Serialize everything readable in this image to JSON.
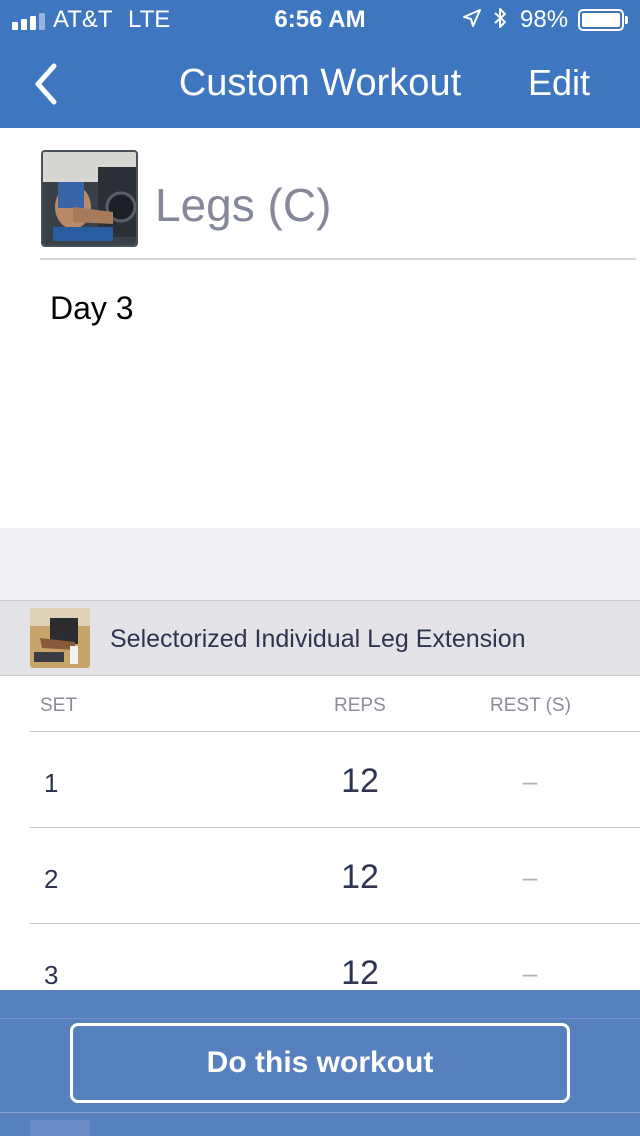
{
  "status_bar": {
    "carrier": "AT&T",
    "network": "LTE",
    "time": "6:56 AM",
    "battery_percent": "98%",
    "signal_bars_active": 3,
    "signal_bars_total": 4,
    "icons": [
      "location-arrow-icon",
      "bluetooth-icon",
      "battery-icon"
    ]
  },
  "nav": {
    "back_icon": "chevron-left-icon",
    "title": "Custom Workout",
    "edit_label": "Edit"
  },
  "workout": {
    "name": "Legs (C)",
    "description": "Day 3"
  },
  "exercise": {
    "name": "Selectorized Individual Leg Extension",
    "columns": {
      "set": "SET",
      "reps": "REPS",
      "rest": "REST (S)"
    },
    "sets": [
      {
        "set": "1",
        "reps": "12",
        "rest": "–"
      },
      {
        "set": "2",
        "reps": "12",
        "rest": "–"
      },
      {
        "set": "3",
        "reps": "12",
        "rest": "–"
      }
    ]
  },
  "footer": {
    "do_workout_label": "Do this workout"
  },
  "colors": {
    "nav_blue": "#3f76c0",
    "footer_blue": "#5780bf",
    "title_gray": "#848898",
    "text_dark": "#2f3452"
  }
}
